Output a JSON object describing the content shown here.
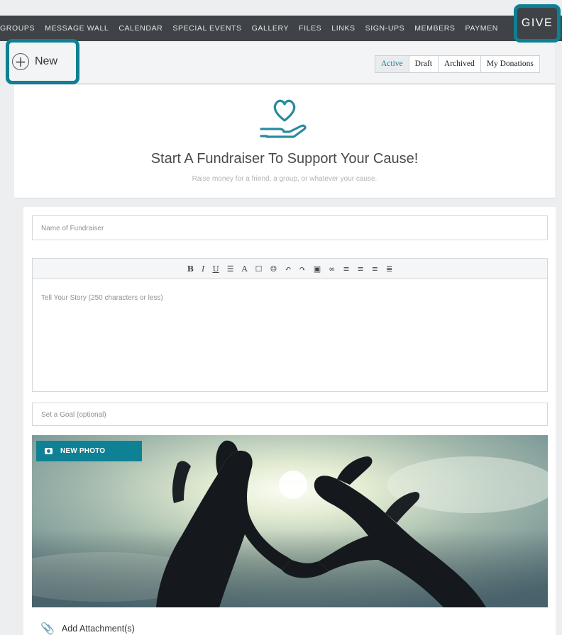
{
  "nav": {
    "items": [
      "GROUPS",
      "MESSAGE WALL",
      "CALENDAR",
      "SPECIAL EVENTS",
      "GALLERY",
      "FILES",
      "LINKS",
      "SIGN-UPS",
      "MEMBERS",
      "PAYMEN"
    ],
    "give_label": "GIVE"
  },
  "toolbar": {
    "new_label": "New",
    "tabs": [
      {
        "label": "Active",
        "active": true
      },
      {
        "label": "Draft",
        "active": false
      },
      {
        "label": "Archived",
        "active": false
      },
      {
        "label": "My Donations",
        "active": false
      }
    ]
  },
  "hero": {
    "icon": "heart-hand-icon",
    "title": "Start A Fundraiser To Support Your Cause!",
    "subtitle": "Raise money for a friend, a group, or whatever your cause."
  },
  "form": {
    "name_placeholder": "Name of Fundraiser",
    "story_placeholder": "Tell Your Story (250 characters or less)",
    "goal_placeholder": "Set a Goal (optional)",
    "editor_tools": [
      "B",
      "I",
      "U",
      "☰",
      "A",
      "☐",
      "☺",
      "↶",
      "↷",
      "▣",
      "∞",
      "≡",
      "≡",
      "≡",
      "≣"
    ],
    "new_photo_label": "NEW PHOTO",
    "attachment_label": "Add Attachment(s)"
  },
  "colors": {
    "accent": "#0f7f94",
    "nav_bg": "#3f4347"
  }
}
